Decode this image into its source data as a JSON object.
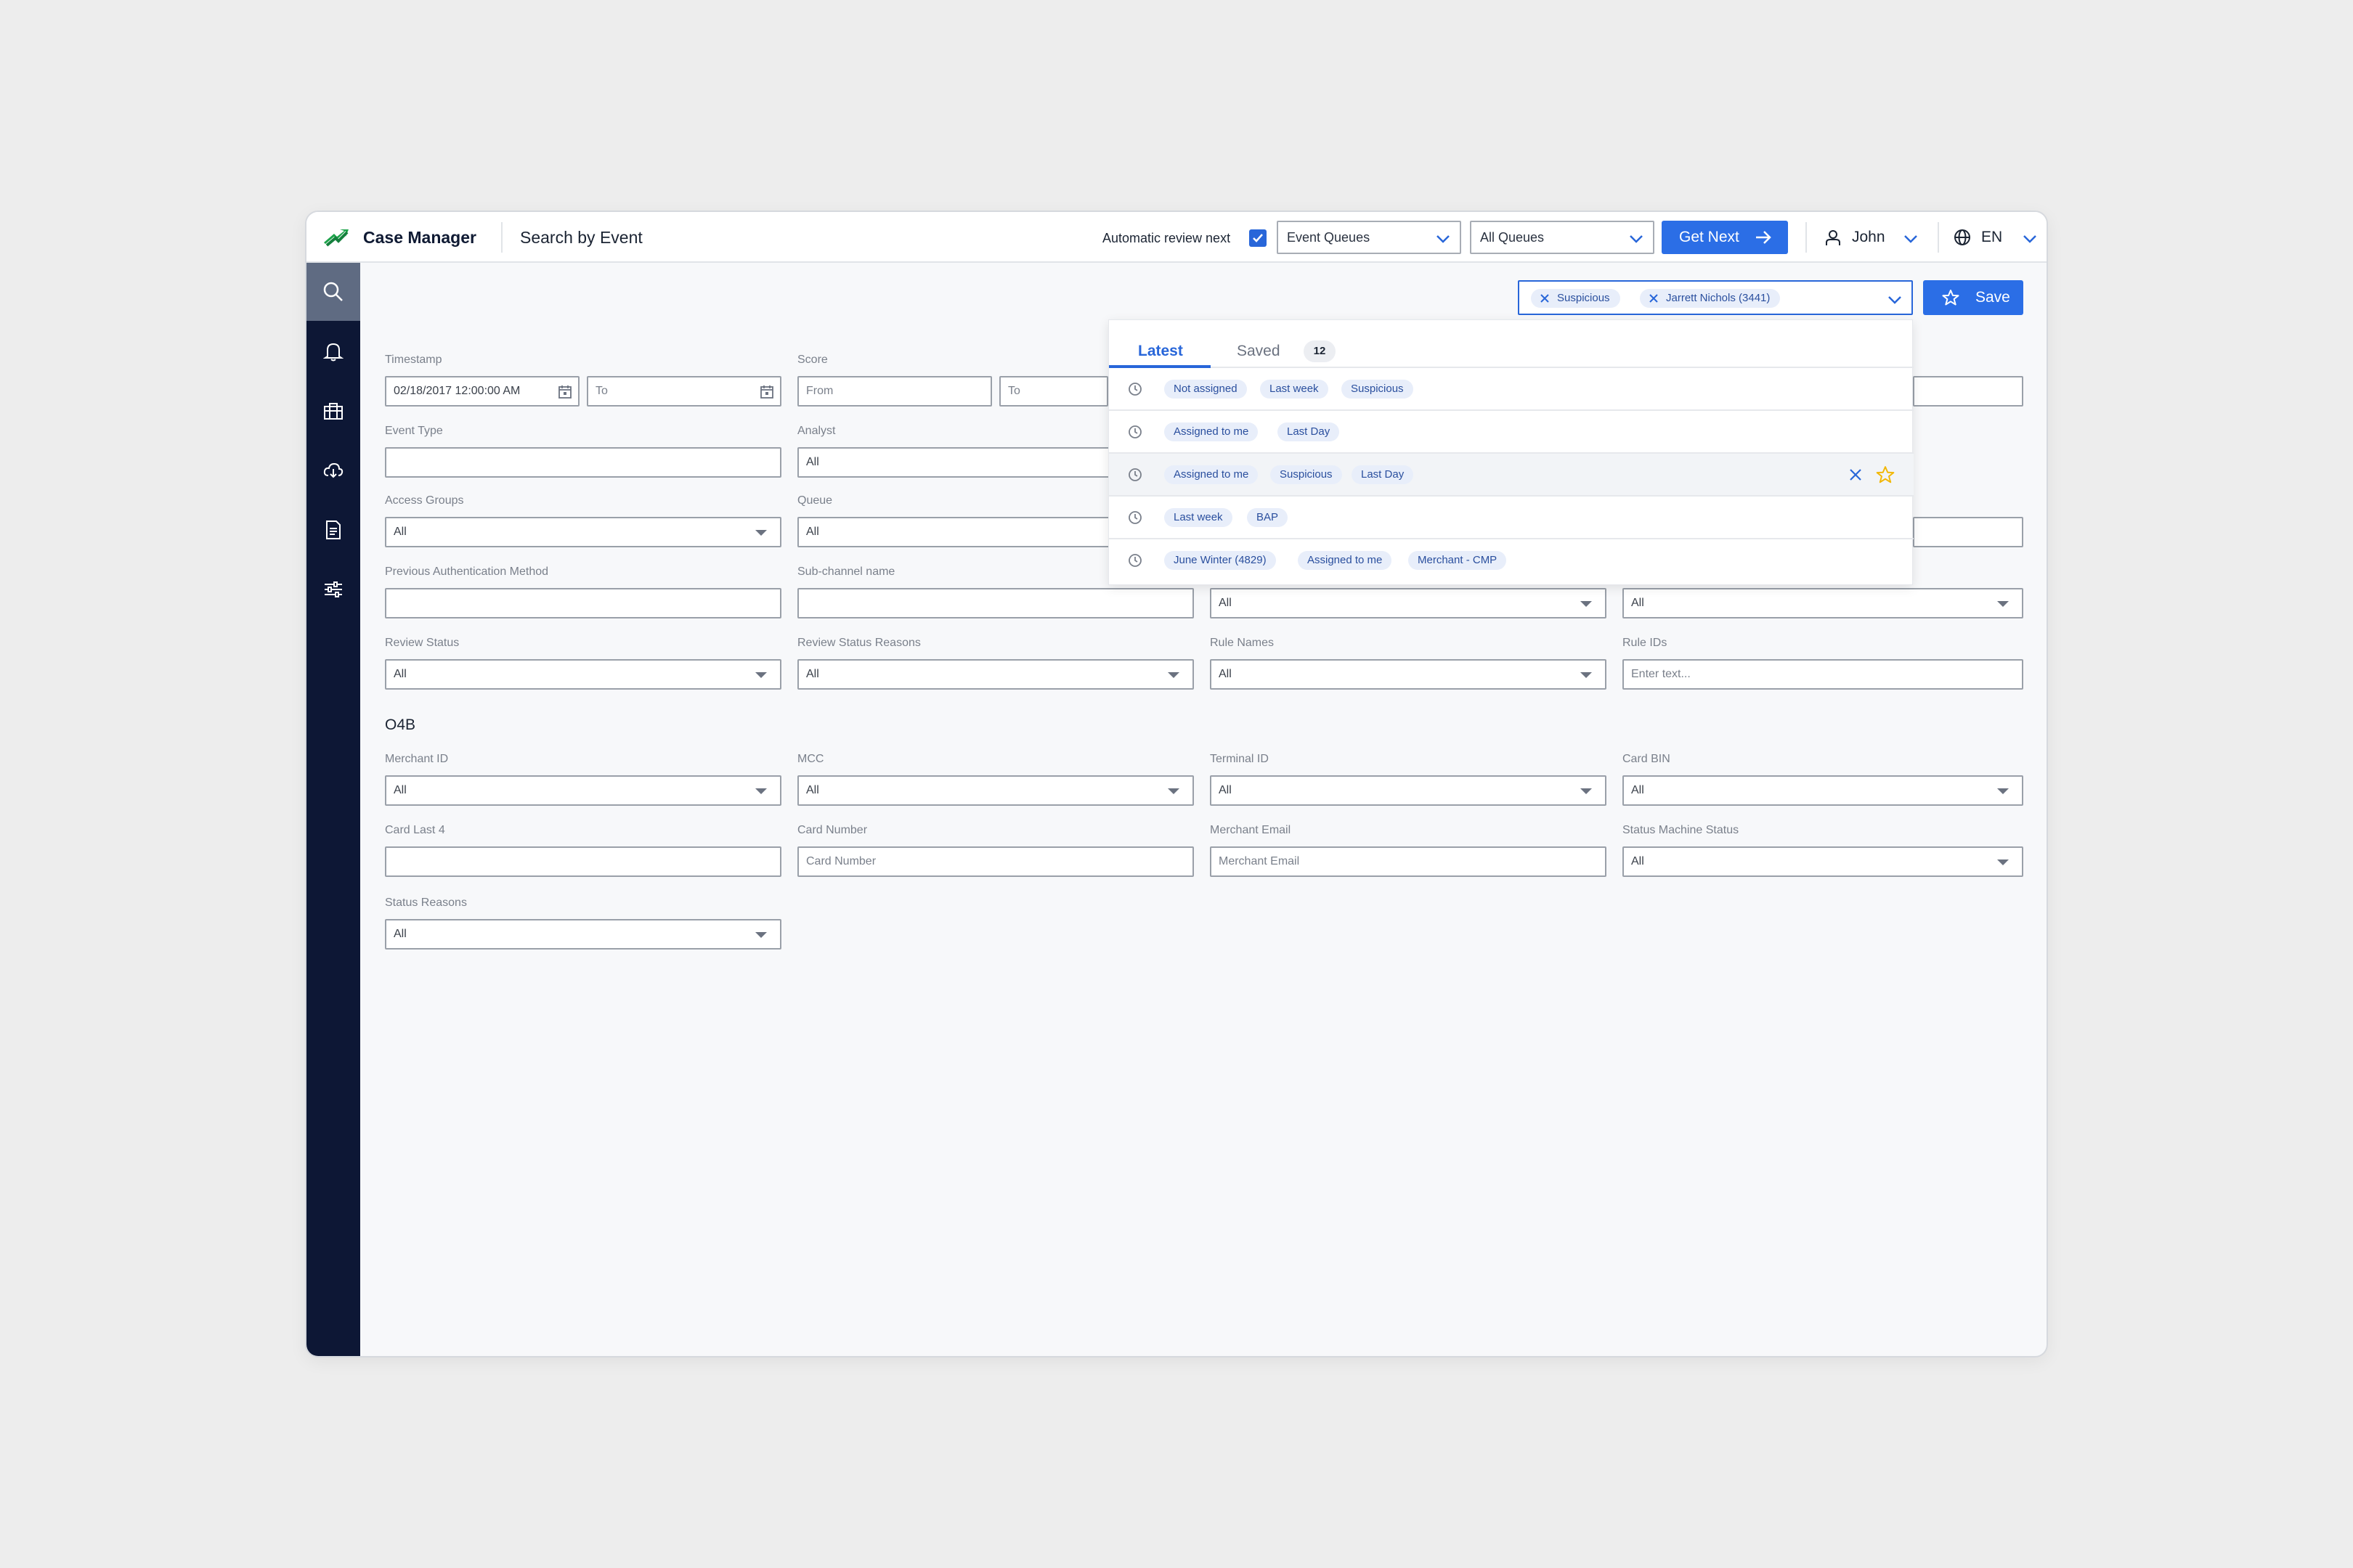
{
  "app": {
    "title": "Case Manager",
    "page_title": "Search by Event"
  },
  "header": {
    "auto_review_label": "Automatic review next",
    "auto_review_checked": true,
    "event_queues": "Event Queues",
    "all_queues": "All Queues",
    "get_next": "Get Next",
    "user": "John",
    "language": "EN"
  },
  "sidebar": {
    "items": [
      "search-icon",
      "bell-icon",
      "briefcase-icon",
      "download-icon",
      "document-icon",
      "sliders-icon"
    ],
    "active": "search-icon"
  },
  "filterbar": {
    "chips": [
      "Suspicious",
      "Jarrett Nichols (3441)"
    ],
    "save": "Save"
  },
  "form": {
    "timestamp": {
      "label": "Timestamp",
      "from": "02/18/2017 12:00:00 AM",
      "to_placeholder": "To"
    },
    "score": {
      "label": "Score",
      "from_placeholder": "From",
      "to_placeholder": "To"
    },
    "event_type": {
      "label": "Event Type",
      "value": ""
    },
    "analyst": {
      "label": "Analyst",
      "value": "All"
    },
    "access_groups": {
      "label": "Access Groups",
      "value": "All"
    },
    "queue": {
      "label": "Queue",
      "value": "All"
    },
    "prev_auth": {
      "label": "Previous Authentication Method",
      "value": ""
    },
    "sub_channel": {
      "label": "Sub-channel name",
      "value": ""
    },
    "row4_col3": {
      "value": "All"
    },
    "row4_col4": {
      "value": "All"
    },
    "review_status": {
      "label": "Review Status",
      "value": "All"
    },
    "review_status_reasons": {
      "label": "Review Status Reasons",
      "value": "All"
    },
    "rule_names": {
      "label": "Rule Names",
      "value": "All"
    },
    "rule_ids": {
      "label": "Rule IDs",
      "placeholder": "Enter text..."
    },
    "section": "O4B",
    "merchant_id": {
      "label": "Merchant ID",
      "value": "All"
    },
    "mcc": {
      "label": "MCC",
      "value": "All"
    },
    "terminal_id": {
      "label": "Terminal ID",
      "value": "All"
    },
    "card_bin": {
      "label": "Card BIN",
      "value": "All"
    },
    "card_last4": {
      "label": "Card Last 4",
      "value": ""
    },
    "card_number": {
      "label": "Card Number",
      "placeholder": "Card Number"
    },
    "merchant_email": {
      "label": "Merchant Email",
      "placeholder": "Merchant Email"
    },
    "status_machine_status": {
      "label": "Status Machine Status",
      "value": "All"
    },
    "status_reasons": {
      "label": "Status Reasons",
      "value": "All"
    }
  },
  "history_panel": {
    "tabs": {
      "latest": "Latest",
      "saved": "Saved",
      "saved_count": "12"
    },
    "rows": [
      [
        "Not assigned",
        "Last week",
        "Suspicious"
      ],
      [
        "Assigned to me",
        "Last Day"
      ],
      [
        "Assigned to me",
        "Suspicious",
        "Last Day"
      ],
      [
        "Last week",
        "BAP"
      ],
      [
        "June Winter (4829)",
        "Assigned  to me",
        "Merchant - CMP"
      ]
    ],
    "highlighted_row": 2
  },
  "colors": {
    "accent": "#2B6EE6",
    "sidebar": "#0D1735",
    "star": "#F2B705",
    "logo": "#1DA34A"
  }
}
